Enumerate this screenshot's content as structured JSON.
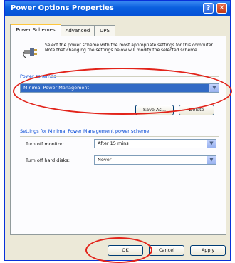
{
  "window": {
    "title": "Power Options Properties"
  },
  "tabs": [
    "Power Schemes",
    "Advanced",
    "UPS"
  ],
  "intro_text": "Select the power scheme with the most appropriate settings for this computer. Note that changing the settings below will modify the selected scheme.",
  "power_schemes": {
    "label": "Power schemes",
    "selected": "Minimal Power Management",
    "save_as_label": "Save As...",
    "delete_label": "Delete"
  },
  "settings": {
    "header": "Settings for Minimal Power Management power scheme",
    "turn_off_monitor_label": "Turn off monitor:",
    "turn_off_monitor_value": "After 15 mins",
    "turn_off_disks_label": "Turn off hard disks:",
    "turn_off_disks_value": "Never"
  },
  "footer": {
    "ok_label": "OK",
    "cancel_label": "Cancel",
    "apply_label": "Apply"
  },
  "annotation_color": "#e2231a"
}
